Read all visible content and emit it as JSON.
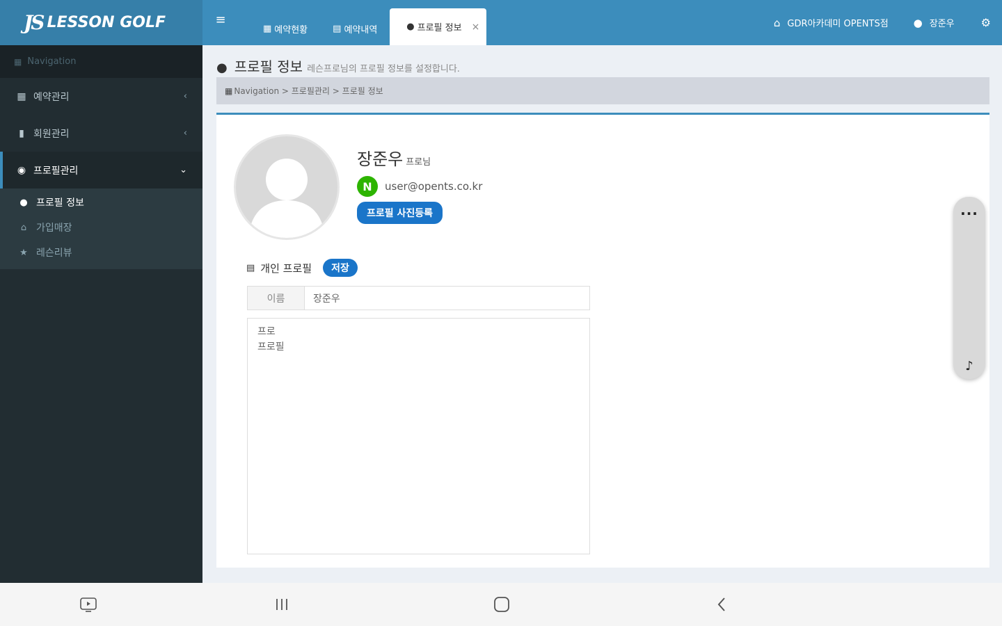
{
  "header": {
    "logo_mark": "JS",
    "logo_text": "LESSON GOLF",
    "menu_icon": "hamburger-icon",
    "tabs": [
      {
        "label": "예약현황",
        "icon": "table-icon"
      },
      {
        "label": "예약내역",
        "icon": "calendar-icon"
      },
      {
        "label": "프로필 정보",
        "icon": "user-icon",
        "active": true
      }
    ],
    "academy": "GDR아카데미 OPENTS점",
    "user": "장준우"
  },
  "sidebar": {
    "nav_header": "Navigation",
    "menus": [
      {
        "label": "예약관리",
        "icon": "calendar-icon"
      },
      {
        "label": "회원관리",
        "icon": "book-icon"
      },
      {
        "label": "프로필관리",
        "icon": "globe-icon",
        "open": true
      }
    ],
    "submenu": [
      {
        "label": "프로필 정보",
        "icon": "user-icon",
        "active": true
      },
      {
        "label": "가입매장",
        "icon": "bank-icon"
      },
      {
        "label": "레슨리뷰",
        "icon": "star-icon"
      }
    ]
  },
  "content": {
    "title": "프로필 정보",
    "subtitle": "레슨프로님의 프로필 정보를 설정합니다.",
    "breadcrumb": [
      "Navigation",
      "프로필관리",
      "프로필 정보"
    ]
  },
  "profile": {
    "name": "장준우",
    "name_suffix": "프로님",
    "email": "user@opents.co.kr",
    "login_badge": "N",
    "photo_button": "프로필 사진등록",
    "section_title": "개인 프로필",
    "save_button": "저장",
    "name_label": "이름",
    "name_value": "장준우",
    "bio": "프로\n프로필"
  },
  "colors": {
    "header": "#3c8dbc",
    "sidebar": "#222d32",
    "button": "#1a75c9",
    "naver": "#2db400"
  }
}
